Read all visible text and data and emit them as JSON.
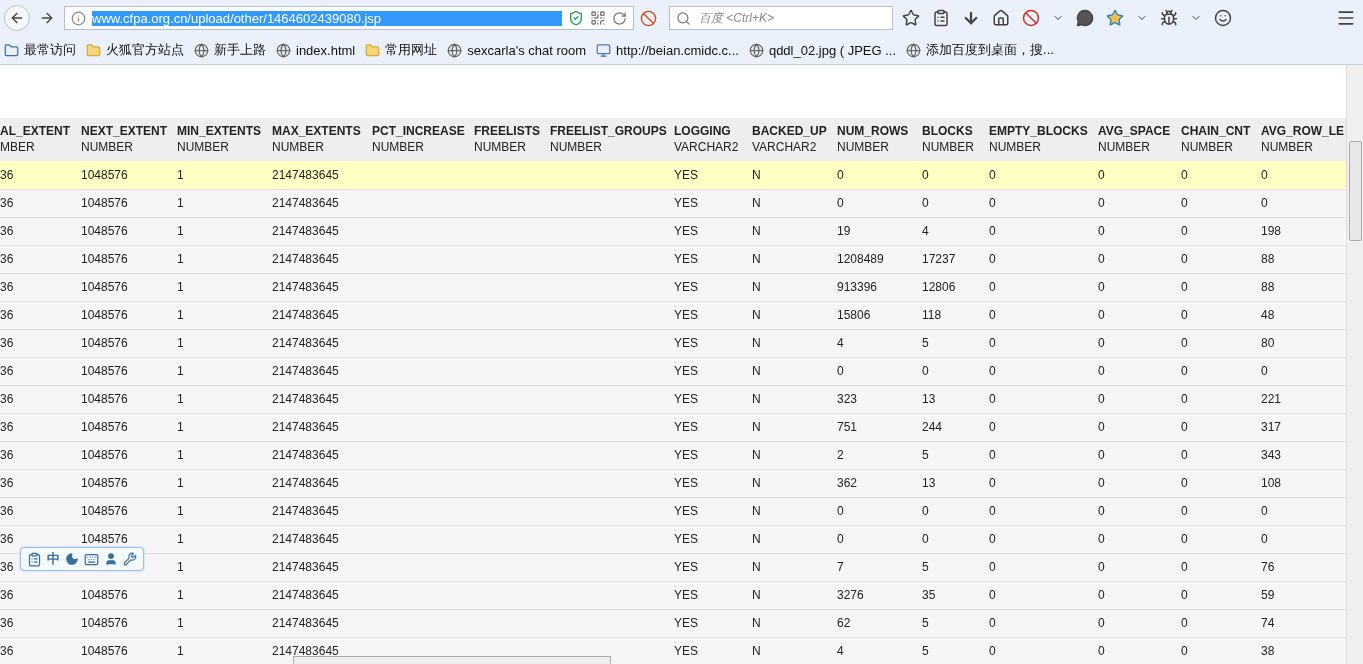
{
  "toolbar": {
    "url": "www.cfpa.org.cn/upload/other/1464602439080.jsp",
    "url_selected": true,
    "search_placeholder": "百度 <Ctrl+K>"
  },
  "bookmarks": [
    {
      "label": "最常访问",
      "kind": "special"
    },
    {
      "label": "火狐官方站点",
      "kind": "folder"
    },
    {
      "label": "新手上路",
      "kind": "page"
    },
    {
      "label": "index.html",
      "kind": "page"
    },
    {
      "label": "常用网址",
      "kind": "folder"
    },
    {
      "label": "sexcarla's chat room",
      "kind": "page"
    },
    {
      "label": "http://beian.cmidc.c...",
      "kind": "site"
    },
    {
      "label": "qddl_02.jpg ( JPEG ...",
      "kind": "page"
    },
    {
      "label": "添加百度到桌面，搜...",
      "kind": "page"
    }
  ],
  "table": {
    "columns": [
      {
        "name": "AL_EXTENT",
        "type": "MBER"
      },
      {
        "name": "NEXT_EXTENT",
        "type": "NUMBER"
      },
      {
        "name": "MIN_EXTENTS",
        "type": "NUMBER"
      },
      {
        "name": "MAX_EXTENTS",
        "type": "NUMBER"
      },
      {
        "name": "PCT_INCREASE",
        "type": "NUMBER"
      },
      {
        "name": "FREELISTS",
        "type": "NUMBER"
      },
      {
        "name": "FREELIST_GROUPS",
        "type": "NUMBER"
      },
      {
        "name": "LOGGING",
        "type": "VARCHAR2"
      },
      {
        "name": "BACKED_UP",
        "type": "VARCHAR2"
      },
      {
        "name": "NUM_ROWS",
        "type": "NUMBER"
      },
      {
        "name": "BLOCKS",
        "type": "NUMBER"
      },
      {
        "name": "EMPTY_BLOCKS",
        "type": "NUMBER"
      },
      {
        "name": "AVG_SPACE",
        "type": "NUMBER"
      },
      {
        "name": "CHAIN_CNT",
        "type": "NUMBER"
      },
      {
        "name": "AVG_ROW_LE",
        "type": "NUMBER"
      }
    ],
    "rows": [
      {
        "selected": true,
        "cells": [
          "36",
          "1048576",
          "1",
          "2147483645",
          null,
          null,
          null,
          "YES",
          "N",
          "0",
          "0",
          "0",
          "0",
          "0",
          "0"
        ]
      },
      {
        "selected": false,
        "cells": [
          "36",
          "1048576",
          "1",
          "2147483645",
          null,
          null,
          null,
          "YES",
          "N",
          "0",
          "0",
          "0",
          "0",
          "0",
          "0"
        ]
      },
      {
        "selected": false,
        "cells": [
          "36",
          "1048576",
          "1",
          "2147483645",
          null,
          null,
          null,
          "YES",
          "N",
          "19",
          "4",
          "0",
          "0",
          "0",
          "198"
        ]
      },
      {
        "selected": false,
        "cells": [
          "36",
          "1048576",
          "1",
          "2147483645",
          null,
          null,
          null,
          "YES",
          "N",
          "1208489",
          "17237",
          "0",
          "0",
          "0",
          "88"
        ]
      },
      {
        "selected": false,
        "cells": [
          "36",
          "1048576",
          "1",
          "2147483645",
          null,
          null,
          null,
          "YES",
          "N",
          "913396",
          "12806",
          "0",
          "0",
          "0",
          "88"
        ]
      },
      {
        "selected": false,
        "cells": [
          "36",
          "1048576",
          "1",
          "2147483645",
          null,
          null,
          null,
          "YES",
          "N",
          "15806",
          "118",
          "0",
          "0",
          "0",
          "48"
        ]
      },
      {
        "selected": false,
        "cells": [
          "36",
          "1048576",
          "1",
          "2147483645",
          null,
          null,
          null,
          "YES",
          "N",
          "4",
          "5",
          "0",
          "0",
          "0",
          "80"
        ]
      },
      {
        "selected": false,
        "cells": [
          "36",
          "1048576",
          "1",
          "2147483645",
          null,
          null,
          null,
          "YES",
          "N",
          "0",
          "0",
          "0",
          "0",
          "0",
          "0"
        ]
      },
      {
        "selected": false,
        "cells": [
          "36",
          "1048576",
          "1",
          "2147483645",
          null,
          null,
          null,
          "YES",
          "N",
          "323",
          "13",
          "0",
          "0",
          "0",
          "221"
        ]
      },
      {
        "selected": false,
        "cells": [
          "36",
          "1048576",
          "1",
          "2147483645",
          null,
          null,
          null,
          "YES",
          "N",
          "751",
          "244",
          "0",
          "0",
          "0",
          "317"
        ]
      },
      {
        "selected": false,
        "cells": [
          "36",
          "1048576",
          "1",
          "2147483645",
          null,
          null,
          null,
          "YES",
          "N",
          "2",
          "5",
          "0",
          "0",
          "0",
          "343"
        ]
      },
      {
        "selected": false,
        "cells": [
          "36",
          "1048576",
          "1",
          "2147483645",
          null,
          null,
          null,
          "YES",
          "N",
          "362",
          "13",
          "0",
          "0",
          "0",
          "108"
        ]
      },
      {
        "selected": false,
        "cells": [
          "36",
          "1048576",
          "1",
          "2147483645",
          null,
          null,
          null,
          "YES",
          "N",
          "0",
          "0",
          "0",
          "0",
          "0",
          "0"
        ]
      },
      {
        "selected": false,
        "cells": [
          "36",
          "1048576",
          "1",
          "2147483645",
          null,
          null,
          null,
          "YES",
          "N",
          "0",
          "0",
          "0",
          "0",
          "0",
          "0"
        ]
      },
      {
        "selected": false,
        "cells": [
          "36",
          null,
          "1",
          "2147483645",
          null,
          null,
          null,
          "YES",
          "N",
          "7",
          "5",
          "0",
          "0",
          "0",
          "76"
        ]
      },
      {
        "selected": false,
        "cells": [
          "36",
          "1048576",
          "1",
          "2147483645",
          null,
          null,
          null,
          "YES",
          "N",
          "3276",
          "35",
          "0",
          "0",
          "0",
          "59"
        ]
      },
      {
        "selected": false,
        "cells": [
          "36",
          "1048576",
          "1",
          "2147483645",
          null,
          null,
          null,
          "YES",
          "N",
          "62",
          "5",
          "0",
          "0",
          "0",
          "74"
        ]
      },
      {
        "selected": false,
        "cells": [
          "36",
          "1048576",
          "1",
          "2147483645",
          null,
          null,
          null,
          "YES",
          "N",
          "4",
          "5",
          "0",
          "0",
          "0",
          "38"
        ]
      }
    ]
  },
  "ime_bar": {
    "mode": "中"
  }
}
